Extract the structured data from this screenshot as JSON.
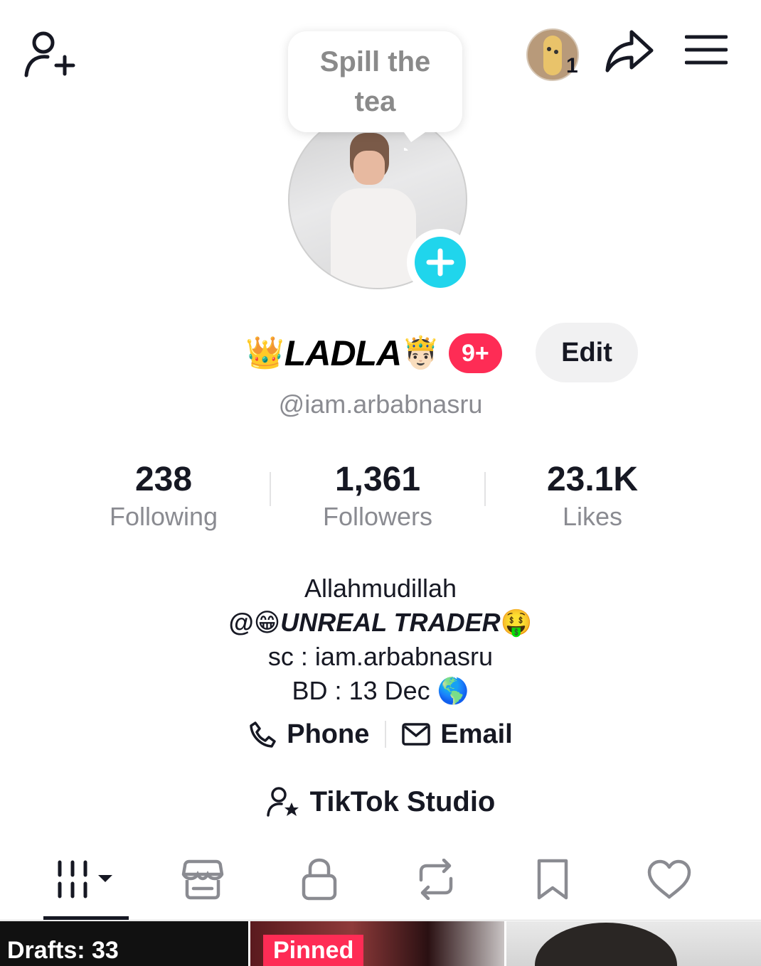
{
  "tooltip": {
    "text": "Spill the tea"
  },
  "header": {
    "notification_count": "1"
  },
  "profile": {
    "name_prefix_emoji": "👑",
    "display_name": "LADLA",
    "name_suffix_emoji": "🤴🏻",
    "badge": "9+",
    "edit_label": "Edit",
    "handle": "@iam.arbabnasru"
  },
  "stats": [
    {
      "value": "238",
      "label": "Following"
    },
    {
      "value": "1,361",
      "label": "Followers"
    },
    {
      "value": "23.1K",
      "label": "Likes"
    }
  ],
  "bio": {
    "line1": "Allahmudillah",
    "line2_prefix": "@😁",
    "line2_bold": "UNREAL TRADER",
    "line2_suffix": "🤑",
    "line3": "sc : iam.arbabnasru",
    "line4": "BD : 13 Dec 🌎"
  },
  "contacts": {
    "phone": "Phone",
    "email": "Email"
  },
  "studio": {
    "label": "TikTok Studio"
  },
  "tabs": [
    {
      "icon": "videos-grid-icon",
      "active": true
    },
    {
      "icon": "shop-icon"
    },
    {
      "icon": "lock-icon"
    },
    {
      "icon": "repost-icon"
    },
    {
      "icon": "bookmark-icon"
    },
    {
      "icon": "heart-icon"
    }
  ],
  "grid": {
    "drafts_label": "Drafts: 33",
    "pinned_label": "Pinned"
  },
  "colors": {
    "accent_red": "#fe2c55",
    "accent_cyan": "#20d5ec",
    "text_primary": "#161823",
    "text_secondary": "#8a8b91"
  }
}
